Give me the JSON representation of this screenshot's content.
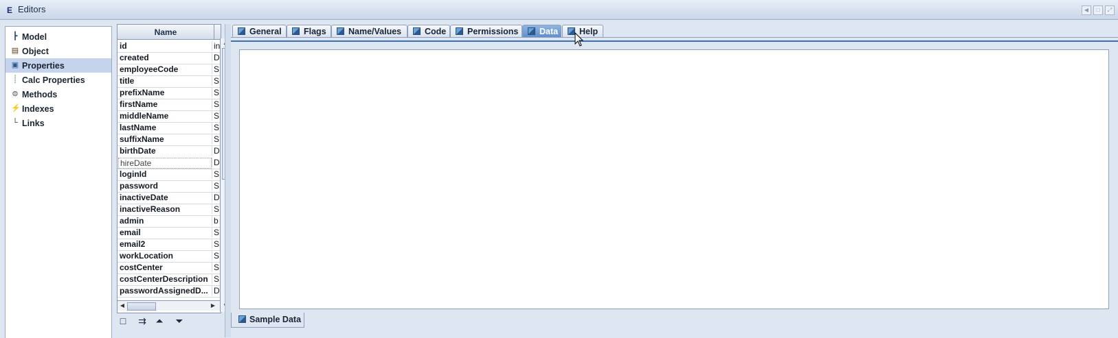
{
  "window": {
    "app_icon": "E",
    "title": "Editors",
    "controls": [
      "minimize-icon",
      "restore-icon",
      "maximize-icon"
    ]
  },
  "nav": {
    "items": [
      {
        "label": "Model",
        "icon": "model-tree-icon"
      },
      {
        "label": "Object",
        "icon": "object-icon"
      },
      {
        "label": "Properties",
        "icon": "properties-icon",
        "selected": true
      },
      {
        "label": "Calc Properties",
        "icon": "calc-properties-icon"
      },
      {
        "label": "Methods",
        "icon": "methods-icon"
      },
      {
        "label": "Indexes",
        "icon": "lightning-icon"
      },
      {
        "label": "Links",
        "icon": "links-icon"
      }
    ]
  },
  "properties_table": {
    "header": "Name",
    "rows": [
      {
        "name": "id",
        "type": "in"
      },
      {
        "name": "created",
        "type": "D"
      },
      {
        "name": "employeeCode",
        "type": "S"
      },
      {
        "name": "title",
        "type": "S"
      },
      {
        "name": "prefixName",
        "type": "S"
      },
      {
        "name": "firstName",
        "type": "S"
      },
      {
        "name": "middleName",
        "type": "S"
      },
      {
        "name": "lastName",
        "type": "S"
      },
      {
        "name": "suffixName",
        "type": "S"
      },
      {
        "name": "birthDate",
        "type": "D"
      },
      {
        "name": "hireDate",
        "type": "D",
        "selected": true
      },
      {
        "name": "loginId",
        "type": "S"
      },
      {
        "name": "password",
        "type": "S"
      },
      {
        "name": "inactiveDate",
        "type": "D"
      },
      {
        "name": "inactiveReason",
        "type": "S"
      },
      {
        "name": "admin",
        "type": "b"
      },
      {
        "name": "email",
        "type": "S"
      },
      {
        "name": "email2",
        "type": "S"
      },
      {
        "name": "workLocation",
        "type": "S"
      },
      {
        "name": "costCenter",
        "type": "S"
      },
      {
        "name": "costCenterDescription",
        "type": "S"
      },
      {
        "name": "passwordAssignedD...",
        "type": "D"
      }
    ],
    "toolbar": [
      "new-icon",
      "insert-icon",
      "move-up-icon",
      "move-down-icon"
    ]
  },
  "editor": {
    "tabs": [
      {
        "label": "General"
      },
      {
        "label": "Flags"
      },
      {
        "label": "Name/Values"
      },
      {
        "label": "Code"
      },
      {
        "label": "Permissions"
      },
      {
        "label": "Data",
        "active": true
      },
      {
        "label": "Help"
      }
    ],
    "bottom_tab": "Sample Data"
  }
}
